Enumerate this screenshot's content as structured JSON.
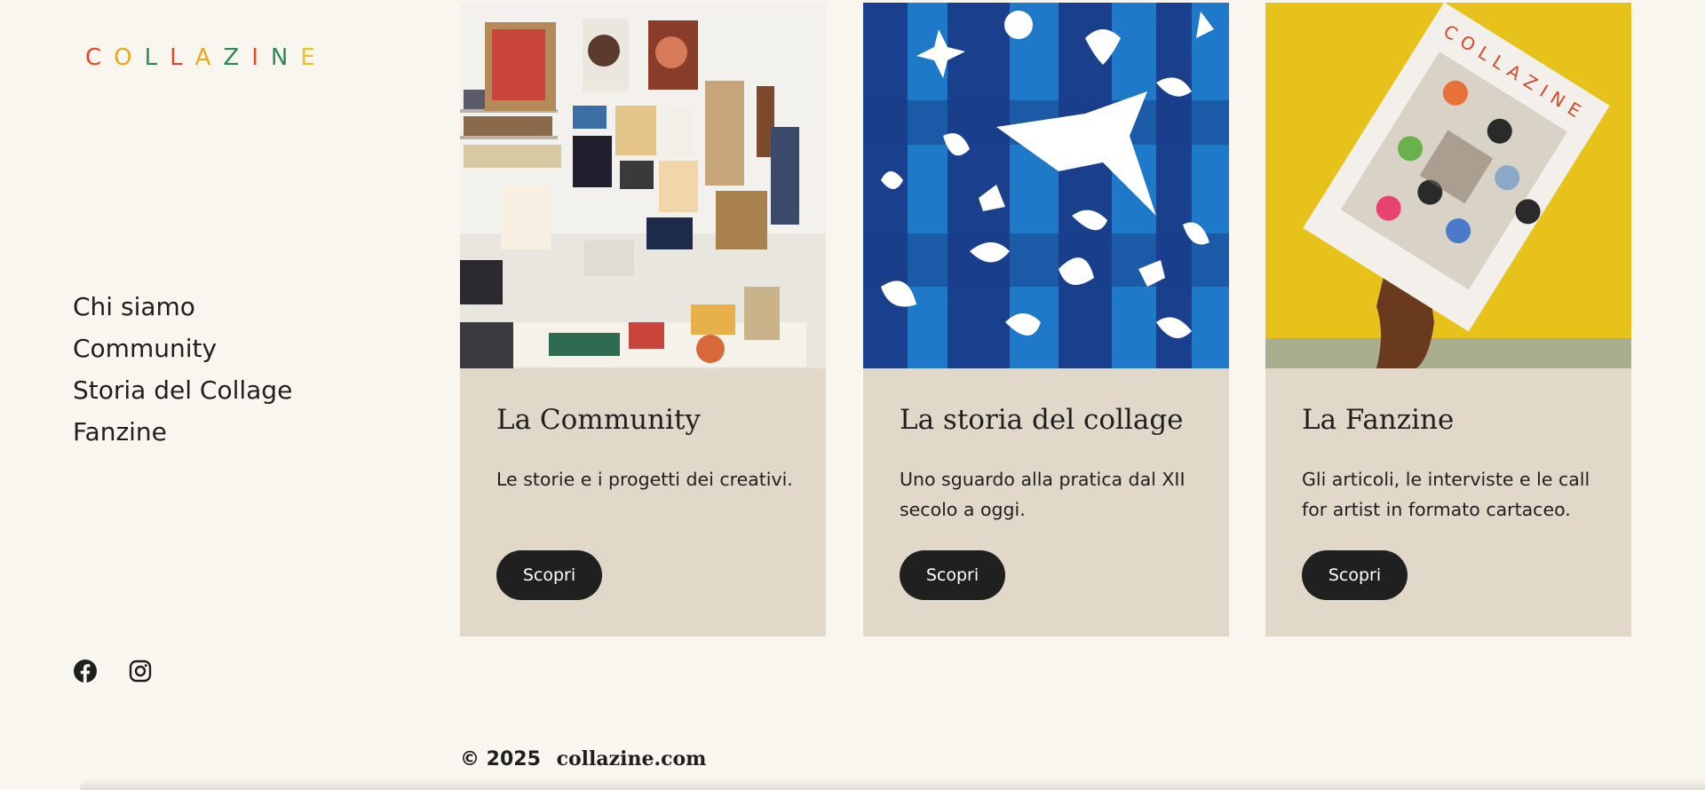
{
  "logo": {
    "letters": [
      "C",
      "O",
      "L",
      "L",
      "A",
      "Z",
      "I",
      "N",
      "E"
    ],
    "colors": [
      "#e8432b",
      "#e8a91b",
      "#2e8a57",
      "#e8432b",
      "#e8a91b",
      "#2e8a57",
      "#e8432b",
      "#2e8a57",
      "#e8c51b"
    ]
  },
  "nav": {
    "items": [
      "Chi siamo",
      "Community",
      "Storia del Collage",
      "Fanzine"
    ]
  },
  "social": {
    "facebook_icon": "facebook-icon",
    "instagram_icon": "instagram-icon"
  },
  "cards": [
    {
      "title": "La Community",
      "text": "Le storie e i progetti dei creativi.",
      "button": "Scopri",
      "image": "studio-wall-with-collages"
    },
    {
      "title": "La storia del collage",
      "text": "Uno sguardo alla pratica dal XII secolo a oggi.",
      "button": "Scopri",
      "image": "blue-cutout-collage"
    },
    {
      "title": "La Fanzine",
      "text": "Gli articoli, le interviste e le call for artist in formato cartaceo.",
      "button": "Scopri",
      "image": "hand-holding-fanzine"
    }
  ],
  "footer": {
    "copyright": "© 2025",
    "site": "collazine.com"
  },
  "colors": {
    "background": "#f9f6ef",
    "card_background": "#e1d8c9",
    "button": "#202020",
    "text": "#1f1f1f"
  }
}
